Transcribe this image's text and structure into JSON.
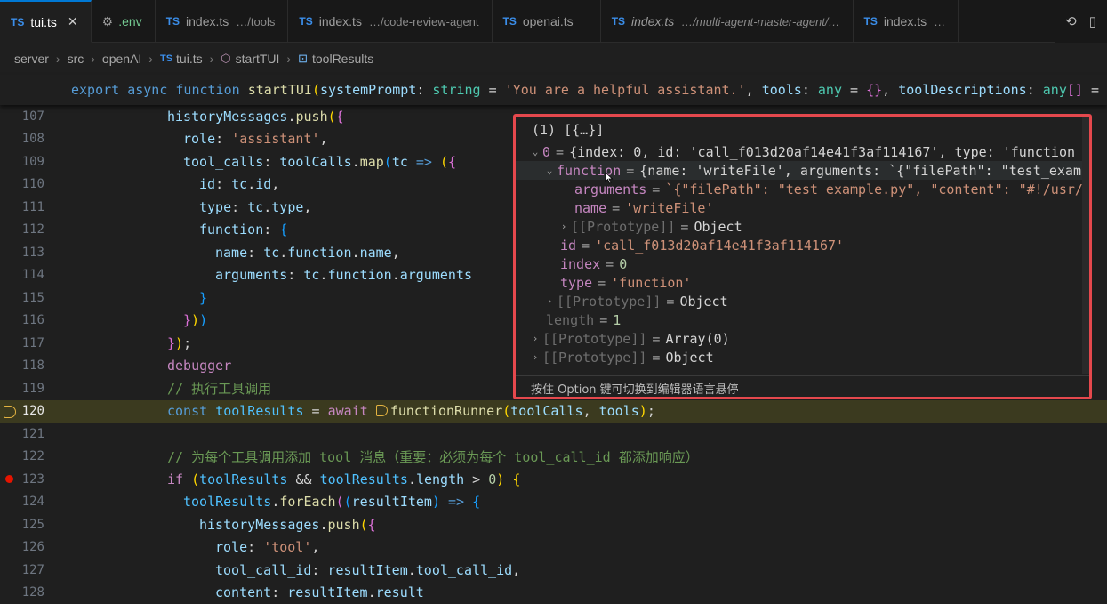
{
  "tabs": [
    {
      "icon": "TS",
      "label": "tui.ts",
      "path": "",
      "active": true,
      "close": "✕"
    },
    {
      "icon": "gear",
      "label": ".env",
      "path": ""
    },
    {
      "icon": "TS",
      "label": "index.ts",
      "path": "…/tools"
    },
    {
      "icon": "TS",
      "label": "index.ts",
      "path": "…/code-review-agent"
    },
    {
      "icon": "TS",
      "label": "openai.ts",
      "path": ""
    },
    {
      "icon": "TS",
      "label": "index.ts",
      "path": "…/multi-agent-master-agent/…"
    },
    {
      "icon": "TS",
      "label": "index.ts",
      "path": "…"
    }
  ],
  "tab_actions": [
    "compare-icon",
    "split-editor-icon"
  ],
  "breadcrumb": [
    "server",
    "src",
    "openAI",
    "tui.ts",
    "startTUI",
    "toolResults"
  ],
  "sticky_line": {
    "export": "export",
    "async": "async",
    "function": "function",
    "name": "startTUI",
    "p1": "systemPrompt",
    "t1": "string",
    "s1": "'You are a helpful assistant.'",
    "p2": "tools",
    "t2": "any",
    "p3": "toolDescriptions",
    "t3": "any"
  },
  "lines": [
    {
      "n": "107"
    },
    {
      "n": "108"
    },
    {
      "n": "109"
    },
    {
      "n": "110"
    },
    {
      "n": "111"
    },
    {
      "n": "112"
    },
    {
      "n": "113"
    },
    {
      "n": "114"
    },
    {
      "n": "115"
    },
    {
      "n": "116"
    },
    {
      "n": "117"
    },
    {
      "n": "118"
    },
    {
      "n": "119"
    },
    {
      "n": "120"
    },
    {
      "n": "121"
    },
    {
      "n": "122"
    },
    {
      "n": "123"
    },
    {
      "n": "124"
    },
    {
      "n": "125"
    },
    {
      "n": "126"
    },
    {
      "n": "127"
    },
    {
      "n": "128"
    }
  ],
  "code": {
    "l107": {
      "obj": "historyMessages",
      "method": "push"
    },
    "l108": {
      "key": "role",
      "val": "'assistant'"
    },
    "l109": {
      "key": "tool_calls",
      "obj": "toolCalls",
      "method": "map",
      "param": "tc"
    },
    "l110": {
      "key": "id",
      "obj": "tc",
      "prop": "id"
    },
    "l111": {
      "key": "type",
      "obj": "tc",
      "prop": "type"
    },
    "l112": {
      "key": "function"
    },
    "l113": {
      "key": "name",
      "obj": "tc",
      "prop1": "function",
      "prop2": "name"
    },
    "l114": {
      "key": "arguments",
      "obj": "tc",
      "prop1": "function",
      "prop2": "arguments"
    },
    "l118": {
      "kw": "debugger"
    },
    "l119": {
      "comment": "// 执行工具调用"
    },
    "l120": {
      "kw": "const",
      "var": "toolResults",
      "aw": "await",
      "fn": "functionRunner",
      "a1": "toolCalls",
      "a2": "tools"
    },
    "l122": {
      "comment": "// 为每个工具调用添加 tool 消息（重要：必须为每个 tool_call_id 都添加响应）"
    },
    "l123": {
      "kw": "if",
      "v1": "toolResults",
      "v2": "toolResults",
      "prop": "length",
      "num": "0"
    },
    "l124": {
      "obj": "toolResults",
      "method": "forEach",
      "param": "resultItem"
    },
    "l125": {
      "obj": "historyMessages",
      "method": "push"
    },
    "l126": {
      "key": "role",
      "val": "'tool'"
    },
    "l127": {
      "key": "tool_call_id",
      "obj": "resultItem",
      "prop": "tool_call_id"
    },
    "l128": {
      "key": "content",
      "obj": "resultItem",
      "prop": "result"
    }
  },
  "hover": {
    "header": "(1) [{…}]",
    "rows": [
      {
        "key": "0",
        "value": "{index: 0, id: 'call_f013d20af14e41f3af114167', type: 'function"
      },
      {
        "key": "function",
        "value": "{name: 'writeFile', arguments: `{\"filePath\": \"test_exam"
      },
      {
        "key": "arguments",
        "value": "`{\"filePath\": \"test_example.py\", \"content\": \"#!/usr/"
      },
      {
        "key": "name",
        "value": "'writeFile'"
      },
      {
        "key": "[[Prototype]]",
        "value": "Object"
      },
      {
        "key": "id",
        "value": "'call_f013d20af14e41f3af114167'"
      },
      {
        "key": "index",
        "value": "0"
      },
      {
        "key": "type",
        "value": "'function'"
      },
      {
        "key": "[[Prototype]]",
        "value": "Object"
      },
      {
        "key": "length",
        "value": "1"
      },
      {
        "key": "[[Prototype]]",
        "value": "Array(0)"
      },
      {
        "key": "[[Prototype]]",
        "value": "Object"
      }
    ],
    "footer": "按住 Option 键可切换到编辑器语言悬停"
  },
  "colors": {
    "accent": "#0078d4",
    "breakpoint": "#e51400",
    "current_line": "#3b3a1f",
    "hover_border": "#e5484d"
  }
}
